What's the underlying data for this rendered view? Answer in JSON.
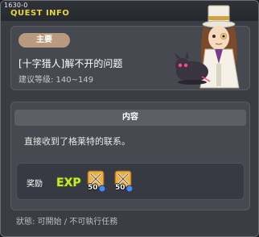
{
  "window": {
    "quest_id": "1630-0",
    "title": "QUEST INFO"
  },
  "quest": {
    "badge": "主要",
    "name": "[十字猎人]解不开的问题",
    "level_label": "建议等级: 140~149"
  },
  "content": {
    "header": "内容",
    "text": "直接收到了格莱特的联系。"
  },
  "reward": {
    "label": "奖励",
    "exp_icon": "exp-icon",
    "items": [
      {
        "icon": "weapon-bundle-icon",
        "count": "50"
      },
      {
        "icon": "weapon-bundle-icon",
        "count": "50"
      }
    ]
  },
  "status": {
    "text": "狀態: 可開始 / 不可執行任務"
  },
  "colors": {
    "title_yellow": "#e6d34a",
    "badge_tan": "#b79a80",
    "panel": "#46494f",
    "window": "#3a3d44"
  }
}
